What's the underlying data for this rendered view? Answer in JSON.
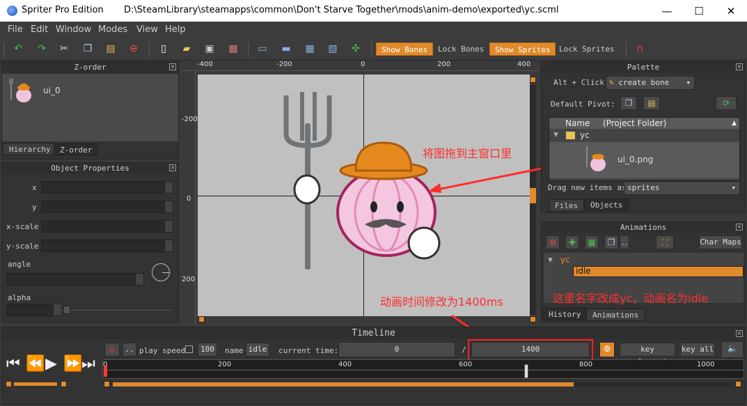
{
  "window": {
    "app_name": "Spriter Pro Edition",
    "path": "D:\\SteamLibrary\\steamapps\\common\\Don't Starve Together\\mods\\anim-demo\\exported\\yc.scml",
    "minimize": "—",
    "maximize": "☐",
    "close": "✕"
  },
  "menu": [
    "File",
    "Edit",
    "Window",
    "Modes",
    "View",
    "Help"
  ],
  "toolbar": {
    "show_bones": "Show Bones",
    "lock_bones": "Lock Bones",
    "show_sprites": "Show Sprites",
    "lock_sprites": "Lock Sprites"
  },
  "zorder": {
    "title": "Z-order",
    "item": "ui_0",
    "tab_hierarchy": "Hierarchy",
    "tab_zorder": "Z-order"
  },
  "object_props": {
    "title": "Object Properties",
    "x": "x",
    "y": "y",
    "x_scale": "x-scale",
    "y_scale": "y-scale",
    "angle": "angle",
    "alpha": "alpha"
  },
  "canvas": {
    "top_ticks": [
      "-400",
      "-200",
      "0",
      "200",
      "400"
    ],
    "left_ticks": [
      "-200",
      "0",
      "200"
    ]
  },
  "annotations": {
    "drag_hint": "将图拖到主窗口里",
    "name_hint": "这里名字改成yc，动画名为idle",
    "time_hint": "动画时间修改为1400ms"
  },
  "palette": {
    "title": "Palette",
    "alt_click": "Alt + Click:",
    "create_bone": "create bone",
    "default_pivot": "Default Pivot:",
    "col_name": "Name",
    "col_folder": "(Project Folder)",
    "folder": "yc",
    "file": "ui_0.png",
    "drag_label": "Drag new items as",
    "drag_value": "sprites",
    "tab_files": "Files",
    "tab_objects": "Objects"
  },
  "animations": {
    "title": "Animations",
    "char_maps": "Char Maps",
    "entity": "yc",
    "anim": "idle",
    "tab_history": "History",
    "tab_animations": "Animations"
  },
  "timeline": {
    "title": "Timeline",
    "play_speed_label": "play speed",
    "play_speed": "100",
    "name_label": "name",
    "name_value": "idle",
    "current_time_label": "current time:",
    "current_time": "0",
    "slash": "/",
    "total_time": "1400",
    "key_selected": "key selected",
    "key_all": "key all",
    "dots": "..",
    "ticks": [
      "0",
      "200",
      "400",
      "600",
      "800",
      "1000"
    ]
  },
  "colors": {
    "accent": "#e08a2c",
    "annotation": "#ff2d2d",
    "selection": "#e08a2c"
  }
}
